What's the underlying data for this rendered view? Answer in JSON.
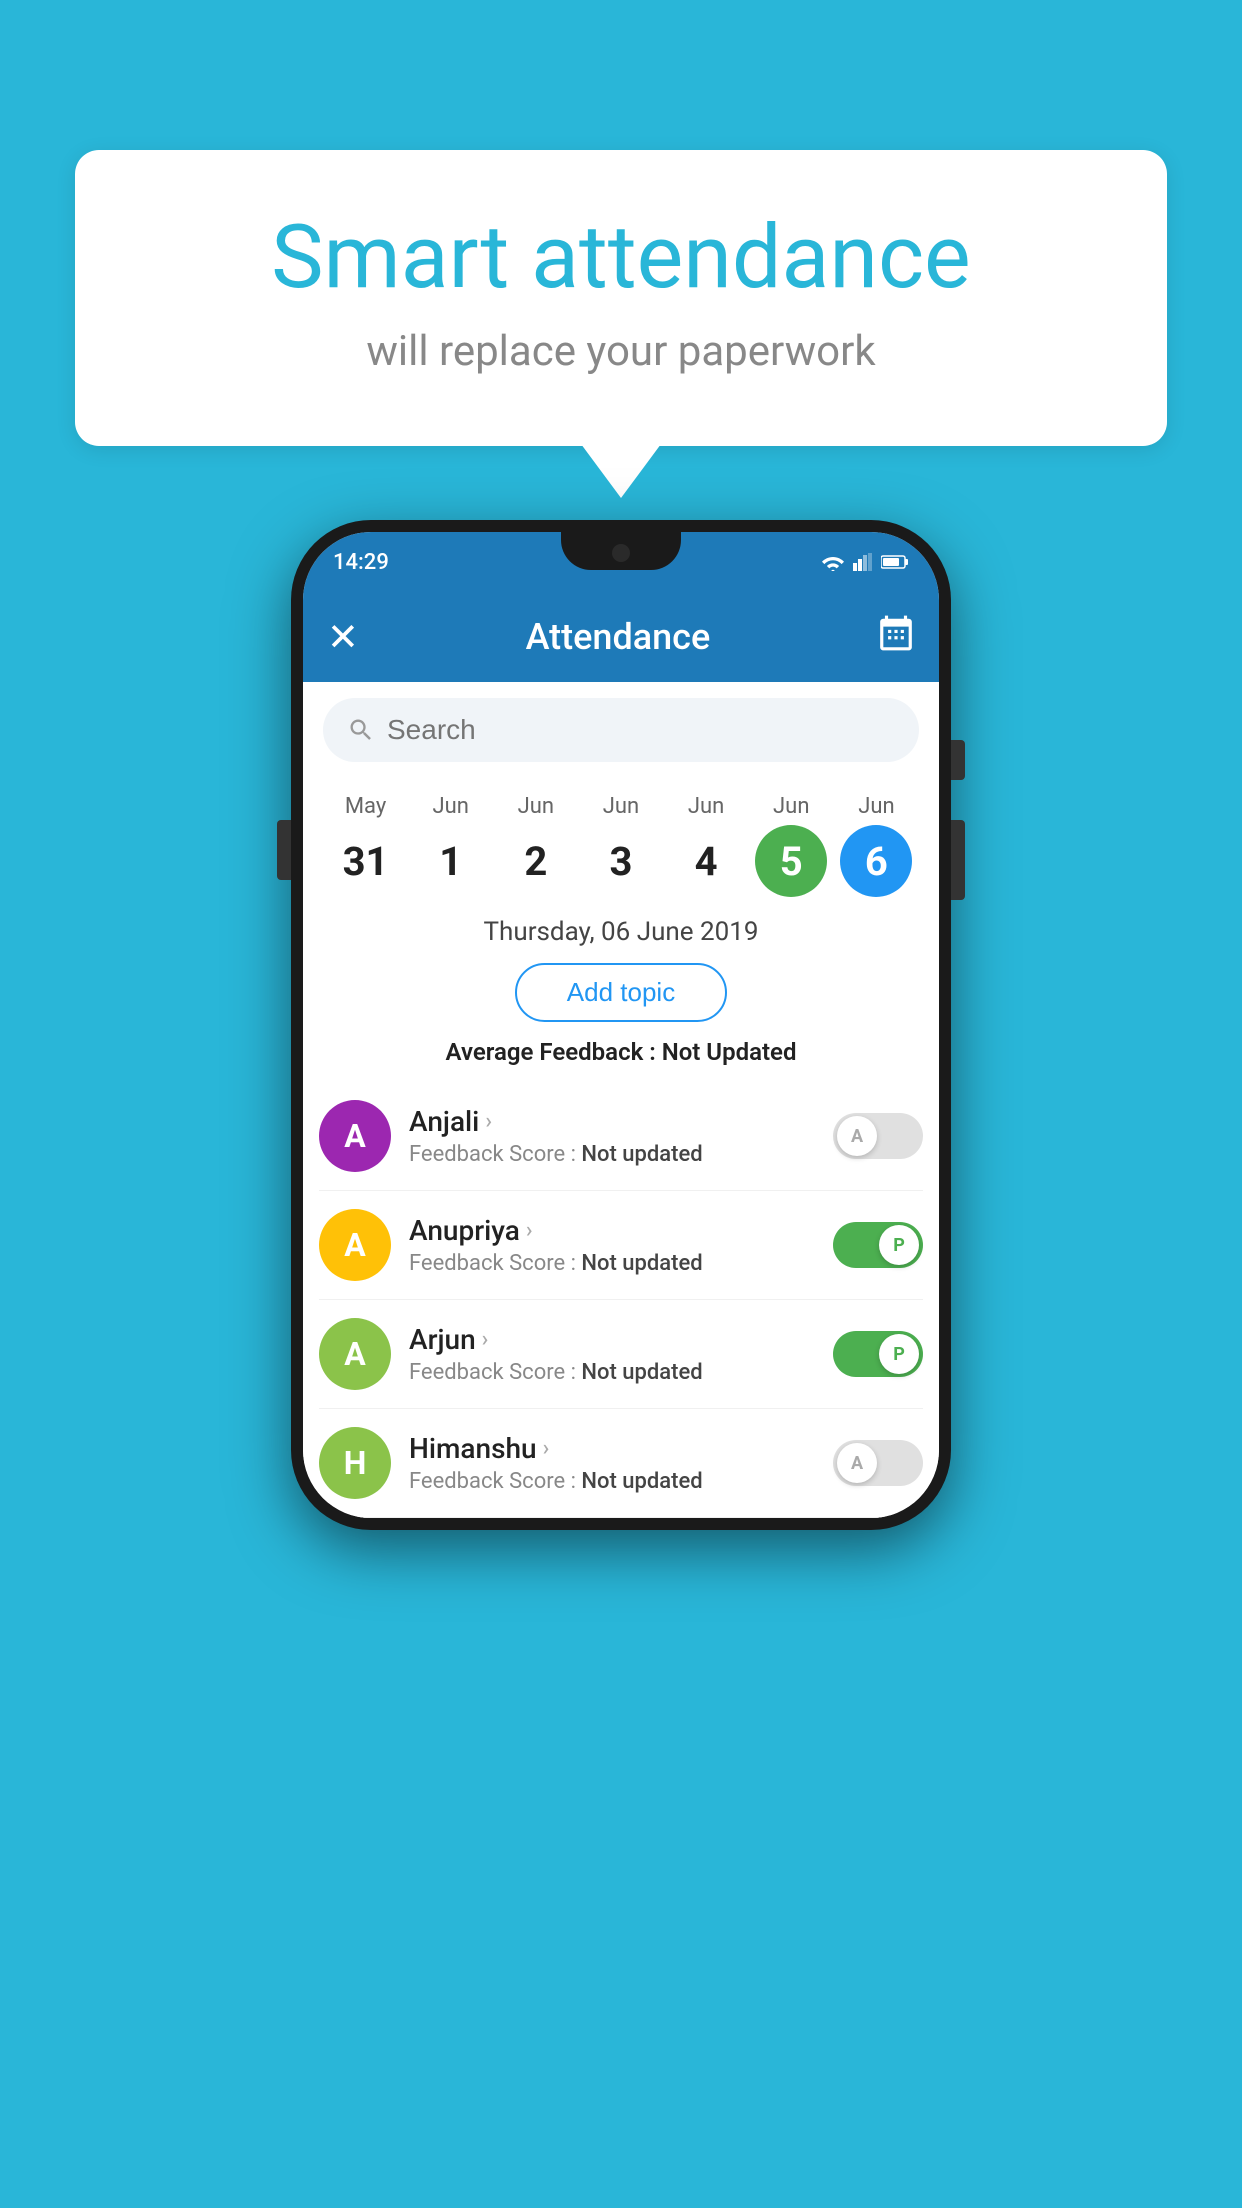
{
  "background_color": "#29b6d8",
  "speech_bubble": {
    "title": "Smart attendance",
    "subtitle": "will replace your paperwork"
  },
  "phone": {
    "status_bar": {
      "time": "14:29"
    },
    "app_bar": {
      "title": "Attendance",
      "close_label": "×",
      "calendar_icon": "calendar"
    },
    "search": {
      "placeholder": "Search"
    },
    "calendar": {
      "days": [
        {
          "month": "May",
          "date": "31",
          "state": "normal"
        },
        {
          "month": "Jun",
          "date": "1",
          "state": "normal"
        },
        {
          "month": "Jun",
          "date": "2",
          "state": "normal"
        },
        {
          "month": "Jun",
          "date": "3",
          "state": "normal"
        },
        {
          "month": "Jun",
          "date": "4",
          "state": "normal"
        },
        {
          "month": "Jun",
          "date": "5",
          "state": "today"
        },
        {
          "month": "Jun",
          "date": "6",
          "state": "selected"
        }
      ]
    },
    "selected_date": "Thursday, 06 June 2019",
    "add_topic_label": "Add topic",
    "avg_feedback_label": "Average Feedback :",
    "avg_feedback_value": "Not Updated",
    "students": [
      {
        "name": "Anjali",
        "avatar_letter": "A",
        "avatar_color": "#9c27b0",
        "feedback_label": "Feedback Score :",
        "feedback_value": "Not updated",
        "attendance": "absent",
        "toggle_label": "A"
      },
      {
        "name": "Anupriya",
        "avatar_letter": "A",
        "avatar_color": "#ffc107",
        "feedback_label": "Feedback Score :",
        "feedback_value": "Not updated",
        "attendance": "present",
        "toggle_label": "P"
      },
      {
        "name": "Arjun",
        "avatar_letter": "A",
        "avatar_color": "#8bc34a",
        "feedback_label": "Feedback Score :",
        "feedback_value": "Not updated",
        "attendance": "present",
        "toggle_label": "P"
      },
      {
        "name": "Himanshu",
        "avatar_letter": "H",
        "avatar_color": "#8bc34a",
        "feedback_label": "Feedback Score :",
        "feedback_value": "Not updated",
        "attendance": "absent",
        "toggle_label": "A"
      }
    ]
  }
}
